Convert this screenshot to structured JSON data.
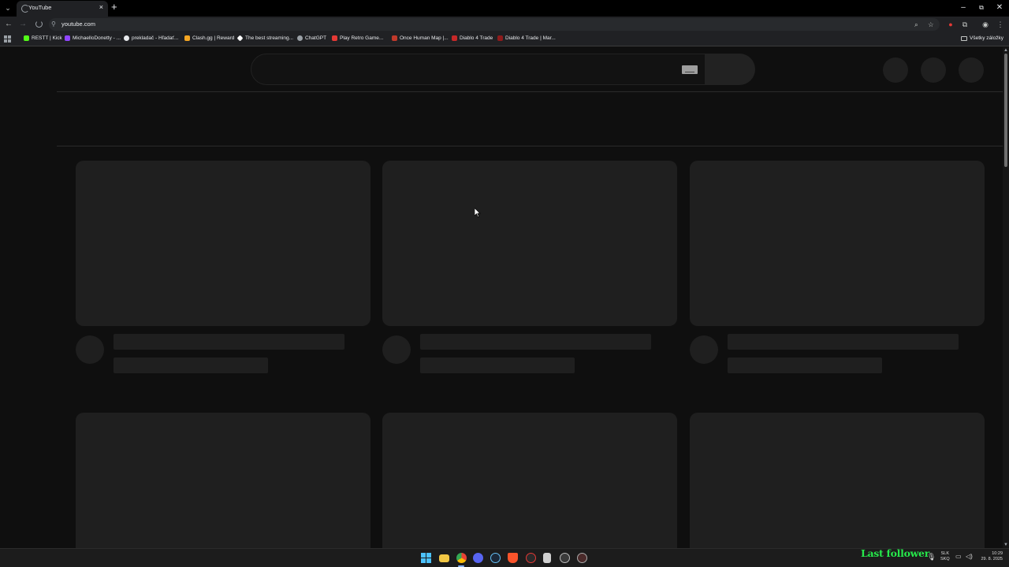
{
  "browser": {
    "tab_title": "YouTube",
    "tab_close_glyph": "×",
    "new_tab_glyph": "+",
    "url": "youtube.com",
    "window_controls": [
      "–",
      "⧉",
      "✕"
    ],
    "nav_glyphs": {
      "back": "←",
      "forward": "→"
    }
  },
  "bookmarks": {
    "items": [
      {
        "label": "RESTT | Kick",
        "icon_color": "#53fc18"
      },
      {
        "label": "MichaelloDonetty - ...",
        "icon_color": "#9146ff"
      },
      {
        "label": "prekladač - Hľadať...",
        "icon_color": "#e8eaed"
      },
      {
        "label": "Clash.gg | Reward",
        "icon_color": "#f5a623"
      },
      {
        "label": "The best streaming...",
        "icon_color": "#ffffff"
      },
      {
        "label": "ChatGPT",
        "icon_color": "#9aa0a6"
      },
      {
        "label": "Play Retro Game...",
        "icon_color": "#e53935"
      },
      {
        "label": "Once Human Map |...",
        "icon_color": "#c0392b"
      },
      {
        "label": "Diablo 4 Trade",
        "icon_color": "#c62828"
      },
      {
        "label": "Diablo 4 Trade | Mar...",
        "icon_color": "#8e1b1b"
      }
    ],
    "all_bookmarks_label": "Všetky záložky"
  },
  "stream_overlay": {
    "text": "Last follower"
  },
  "tray": {
    "lang_top": "SLK",
    "lang_bottom": "SKQ",
    "time": "10:29",
    "date": "29. 8. 2025"
  },
  "colors": {
    "page_bg": "#0f0f0f",
    "skeleton": "#1f1f1f",
    "overlay_green": "#26e84b"
  }
}
